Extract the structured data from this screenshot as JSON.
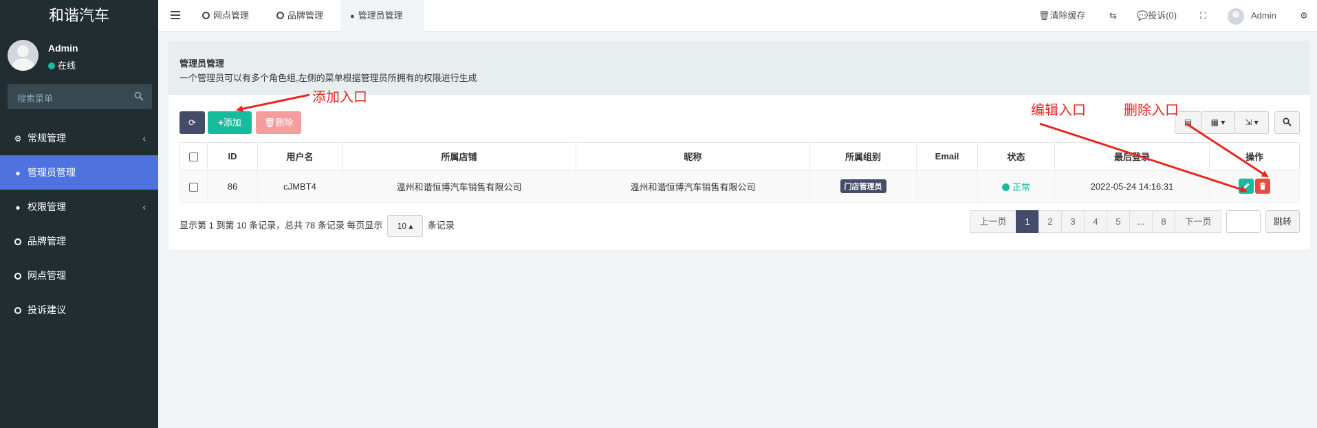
{
  "brand": "和谐汽车",
  "user": {
    "name": "Admin",
    "status": "在线"
  },
  "search": {
    "placeholder": "搜索菜单"
  },
  "sidebar": {
    "items": [
      {
        "label": "常规管理",
        "icon": "cogs-icon"
      },
      {
        "label": "管理员管理",
        "icon": "user-icon"
      },
      {
        "label": "权限管理",
        "icon": "group-icon"
      },
      {
        "label": "品牌管理",
        "icon": "circle-icon"
      },
      {
        "label": "网点管理",
        "icon": "circle-icon"
      },
      {
        "label": "投诉建议",
        "icon": "circle-icon"
      }
    ]
  },
  "topbar": {
    "tabs": [
      {
        "label": "网点管理"
      },
      {
        "label": "品牌管理"
      },
      {
        "label": "管理员管理"
      }
    ],
    "clear_cache": "清除缓存",
    "complaints": "投诉(0)",
    "admin": "Admin"
  },
  "panel": {
    "title": "管理员管理",
    "description": "一个管理员可以有多个角色组,左侧的菜单根据管理员所拥有的权限进行生成"
  },
  "toolbar": {
    "add_label": "添加",
    "delete_label": "删除"
  },
  "table": {
    "headers": [
      "ID",
      "用户名",
      "所属店铺",
      "昵称",
      "所属组别",
      "Email",
      "状态",
      "最后登录",
      "操作"
    ],
    "rows": [
      {
        "id": "86",
        "username": "cJMBT4",
        "store": "温州和谐恒博汽车销售有限公司",
        "nickname": "温州和谐恒博汽车销售有限公司",
        "group": "门店管理员",
        "email": "",
        "status": "正常",
        "last_login": "2022-05-24 14:16:31"
      }
    ]
  },
  "pagination": {
    "info_prefix": "显示第 1 到第 10 条记录，总共 78 条记录 每页显示",
    "page_size": "10",
    "info_suffix": "条记录",
    "prev": "上一页",
    "pages": [
      "1",
      "2",
      "3",
      "4",
      "5",
      "...",
      "8"
    ],
    "next": "下一页",
    "jump": "跳转"
  },
  "annotations": {
    "add": "添加入口",
    "edit": "编辑入口",
    "delete": "删除入口"
  },
  "colors": {
    "sidebar": "#222d32",
    "active": "#4e73df",
    "success": "#18bc9c",
    "danger": "#e74c3c",
    "dark": "#444c69",
    "annotation": "#e8261f"
  }
}
